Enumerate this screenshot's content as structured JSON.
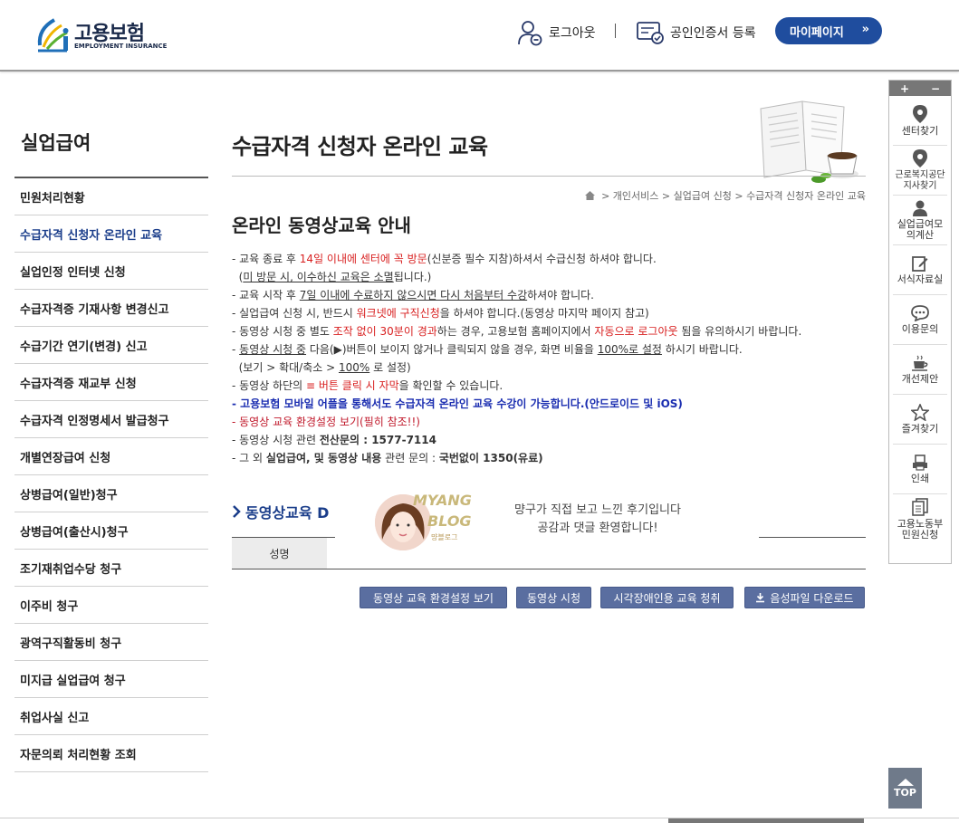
{
  "header": {
    "logo_text": "고용보험",
    "logo_sub": "EMPLOYMENT INSURANCE",
    "logout": "로그아웃",
    "cert_register": "공인인증서 등록",
    "mypage": "마이페이지"
  },
  "sidebar": {
    "title": "실업급여",
    "items": [
      "민원처리현황",
      "수급자격 신청자 온라인 교육",
      "실업인정 인터넷 신청",
      "수급자격증 기재사항 변경신고",
      "수급기간 연기(변경) 신고",
      "수급자격증 재교부 신청",
      "수급자격 인정명세서 발급청구",
      "개별연장급여 신청",
      "상병급여(일반)청구",
      "상병급여(출산시)청구",
      "조기재취업수당 청구",
      "이주비 청구",
      "광역구직활동비 청구",
      "미지급 실업급여 청구",
      "취업사실 신고",
      "자문의뢰 처리현황 조회"
    ],
    "active_index": 1
  },
  "main": {
    "title": "수급자격 신청자 온라인 교육",
    "breadcrumb": [
      "개인서비스",
      "실업급여 신청",
      "수급자격 신청자 온라인 교육"
    ],
    "section_title": "온라인 동영상교육 안내",
    "notice": {
      "l1_a": "- 교육 종료 후 ",
      "l1_b": "14일 이내에 센터에 꼭 방문",
      "l1_c": "(신분증 필수 지참)하셔서 수급신청 하셔야 합니다.",
      "l2_a": "  (",
      "l2_b": "미 방문 시, 이수하신 교육은 소멸",
      "l2_c": "됩니다.)",
      "l3_a": "- 교육 시작 후 ",
      "l3_b": "7일 이내에 수료하지 않으시면 다시 처음부터 수강",
      "l3_c": "하셔야 합니다.",
      "l4_a": "- 실업급여 신청 시, 반드시 ",
      "l4_b": "워크넷에 구직신청",
      "l4_c": "을 하셔야 합니다.(동영상 마지막 페이지 참고)",
      "l5_a": "- 동영상 시청 중 별도 ",
      "l5_b": "조작 없이 30분이 경과",
      "l5_c": "하는 경우, 고용보험 홈페이지에서 ",
      "l5_d": "자동으로 로그아웃",
      "l5_e": " 됨을 유의하시기 바랍니다.",
      "l6_a": "- ",
      "l6_b": "동영상 시청 중",
      "l6_c": " 다음(▶)버튼이 보이지 않거나 클릭되지 않을 경우, 화면 비율을 ",
      "l6_d": "100%로 설정",
      "l6_e": " 하시기 바랍니다.",
      "l7_a": "  (보기 > 확대/축소 > ",
      "l7_b": "100%",
      "l7_c": " 로 설정)",
      "l8_a": "- 동영상 하단의 ",
      "l8_b": "≡ 버튼 클릭 시 자막",
      "l8_c": "을 확인할 수 있습니다.",
      "l9": "- 고용보험 모바일 어플을 통해서도 수급자격 온라인 교육 수강이 가능합니다.(안드로이드 및 iOS)",
      "l10": "- 동영상 교육 환경설정 보기(필히 참조!!)",
      "l11_a": "- 동영상 시청 관련 ",
      "l11_b": "전산문의 : 1577-7114",
      "l12_a": "- 그 외 ",
      "l12_b": "실업급여, 및 동영상 내용",
      "l12_c": " 관련 문의 : ",
      "l12_d": "국번없이 1350(유료)"
    },
    "sub_heading": "동영상교육 D",
    "table_header_name": "성명",
    "banner": {
      "logo_line1": "MYANG",
      "logo_line2": "BLOG",
      "logo_sub": "먕블로그",
      "text_line1": "먕구가 직접 보고 느낀 후기입니다",
      "text_line2": "공감과 댓글 환영합니다!"
    },
    "buttons": {
      "env": "동영상 교육 환경설정 보기",
      "watch": "동영상 시청",
      "visual": "시각장애인용 교육 청취",
      "download": "음성파일 다운로드"
    }
  },
  "quick_menu": {
    "plus": "+",
    "minus": "−",
    "items": [
      {
        "label": "센터찾기",
        "icon": "location-pin-icon"
      },
      {
        "label": "근로복지공단지사찾기",
        "icon": "location-pin-icon"
      },
      {
        "label": "실업급여모의계산",
        "icon": "person-icon"
      },
      {
        "label": "서식자료실",
        "icon": "edit-document-icon"
      },
      {
        "label": "이용문의",
        "icon": "speech-bubble-icon"
      },
      {
        "label": "개선제안",
        "icon": "coffee-cup-icon"
      },
      {
        "label": "즐겨찾기",
        "icon": "star-icon"
      },
      {
        "label": "인쇄",
        "icon": "printer-icon"
      },
      {
        "label": "고용노동부민원신청",
        "icon": "documents-icon"
      }
    ]
  },
  "top_button": "TOP"
}
